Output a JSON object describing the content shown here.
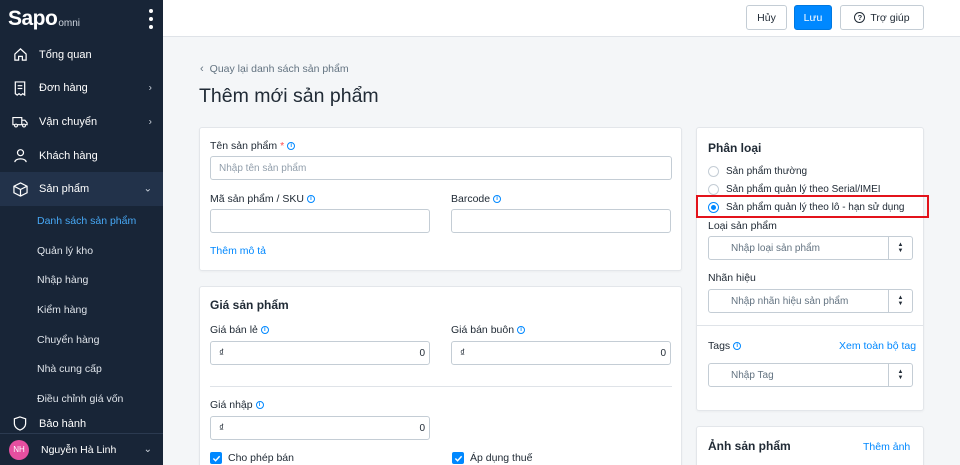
{
  "app": {
    "logo": "Sapo",
    "logo_sub": "omni"
  },
  "sidebar": {
    "items": [
      {
        "label": "Tổng quan",
        "icon": "home-icon"
      },
      {
        "label": "Đơn hàng",
        "icon": "receipt-icon",
        "has_chevron": true
      },
      {
        "label": "Vận chuyển",
        "icon": "truck-icon",
        "has_chevron": true
      },
      {
        "label": "Khách hàng",
        "icon": "person-icon"
      },
      {
        "label": "Sản phẩm",
        "icon": "box-icon",
        "expanded": true
      }
    ],
    "sub_items": [
      "Danh sách sản phẩm",
      "Quản lý kho",
      "Nhập hàng",
      "Kiểm hàng",
      "Chuyển hàng",
      "Nhà cung cấp",
      "Điều chỉnh giá vốn"
    ],
    "active_sub": "Danh sách sản phẩm",
    "partial_item": "Bảo hành",
    "user": {
      "initials": "NH",
      "name": "Nguyễn Hà Linh"
    }
  },
  "toolbar": {
    "cancel_label": "Hủy",
    "save_label": "Lưu",
    "help_label": "Trợ giúp"
  },
  "main": {
    "back_link": "Quay lại danh sách sản phẩm",
    "title": "Thêm mới sản phẩm"
  },
  "product_form": {
    "name_label": "Tên sản phẩm",
    "name_required_mark": "*",
    "name_placeholder": "Nhập tên sản phẩm",
    "sku_label": "Mã sản phẩm / SKU",
    "barcode_label": "Barcode",
    "add_description": "Thêm mô tả"
  },
  "price": {
    "title": "Giá sản phẩm",
    "retail_label": "Giá bán lẻ",
    "wholesale_label": "Giá bán buôn",
    "import_label": "Giá nhập",
    "currency": "₫",
    "retail_value": "0",
    "wholesale_value": "0",
    "import_value": "0",
    "allow_sale_label": "Cho phép bán",
    "apply_tax_label": "Áp dụng thuế"
  },
  "classification": {
    "title": "Phân loại",
    "options": [
      "Sản phẩm thường",
      "Sản phẩm quản lý theo Serial/IMEI",
      "Sản phẩm quản lý theo lô - hạn sử dụng"
    ],
    "selected_index": 2,
    "type_label": "Loại sản phẩm",
    "type_placeholder": "Nhập loại sản phẩm",
    "brand_label": "Nhãn hiệu",
    "brand_placeholder": "Nhập nhãn hiệu sản phẩm",
    "tags_label": "Tags",
    "view_all_tags": "Xem toàn bộ tag",
    "tag_placeholder": "Nhập Tag"
  },
  "images": {
    "title": "Ảnh sản phẩm",
    "add_label": "Thêm ảnh"
  },
  "colors": {
    "sidebar_bg": "#182537",
    "primary": "#0088ff",
    "highlight": "#e3131b",
    "avatar": "#e64fa0"
  }
}
